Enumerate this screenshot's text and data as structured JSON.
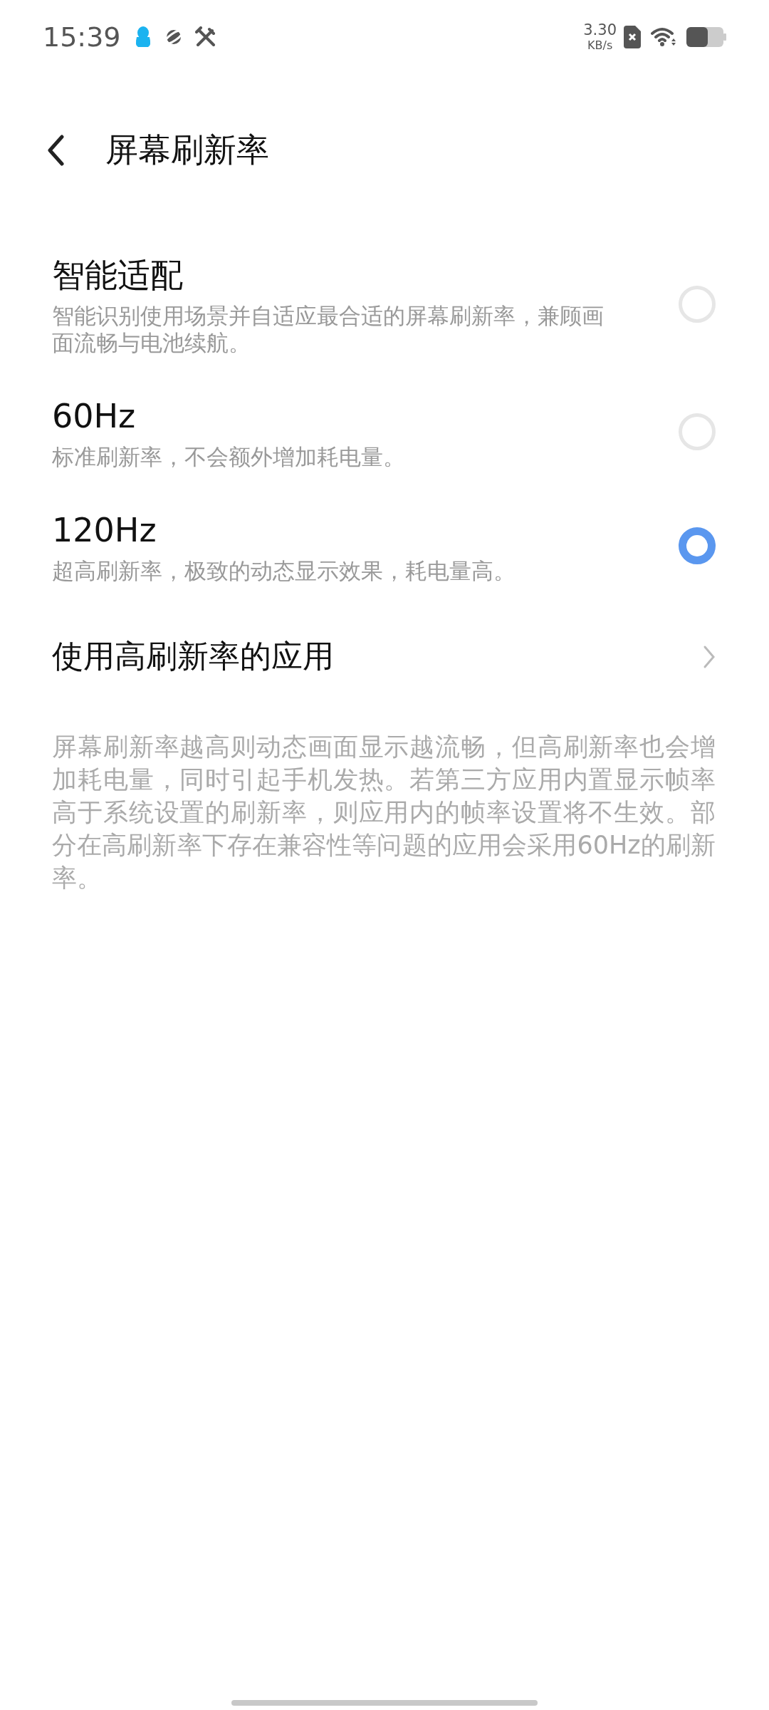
{
  "status_bar": {
    "time": "15:39",
    "speed_value": "3.30",
    "speed_unit": "KB/s"
  },
  "header": {
    "title": "屏幕刷新率"
  },
  "options": [
    {
      "title": "智能适配",
      "description": "智能识别使用场景并自适应最合适的屏幕刷新率，兼顾画面流畅与电池续航。",
      "selected": false
    },
    {
      "title": "60Hz",
      "description": "标准刷新率，不会额外增加耗电量。",
      "selected": false
    },
    {
      "title": "120Hz",
      "description": "超高刷新率，极致的动态显示效果，耗电量高。",
      "selected": true
    }
  ],
  "link_row": {
    "label": "使用高刷新率的应用"
  },
  "note": "屏幕刷新率越高则动态画面显示越流畅，但高刷新率也会增加耗电量，同时引起手机发热。若第三方应用内置显示帧率高于系统设置的刷新率，则应用内的帧率设置将不生效。部分在高刷新率下存在兼容性等问题的应用会采用60Hz的刷新率。"
}
